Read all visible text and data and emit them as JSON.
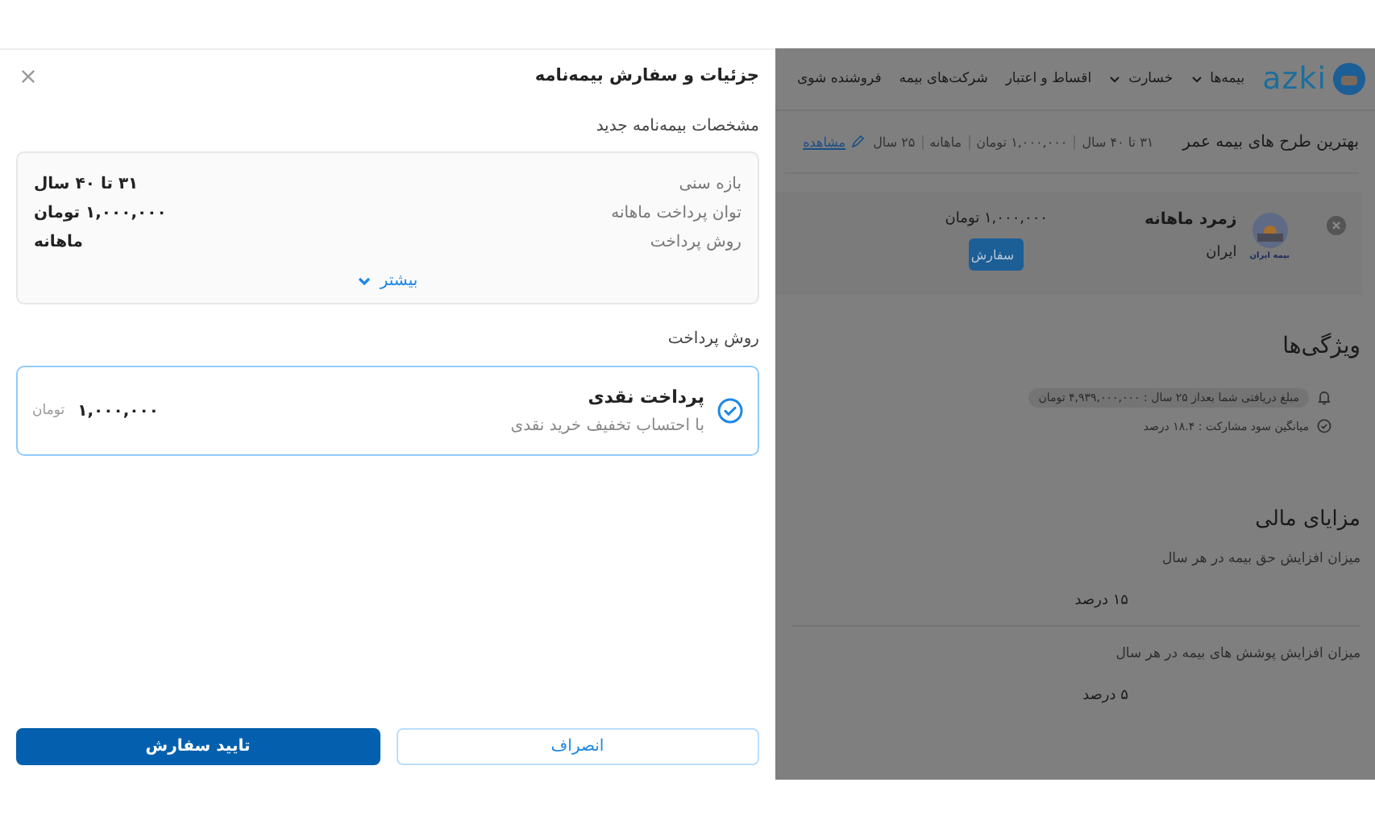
{
  "drawer": {
    "title": "جزئیات و سفارش بیمه‌نامه",
    "section_title": "مشخصات بیمه‌نامه جدید",
    "specs": [
      {
        "label": "بازه سنی",
        "value": "۳۱ تا ۴۰ سال"
      },
      {
        "label": "توان پرداخت ماهانه",
        "value": "۱,۰۰۰,۰۰۰ تومان"
      },
      {
        "label": "روش پرداخت",
        "value": "ماهانه"
      }
    ],
    "more_link": "بیشتر",
    "payment_title": "روش پرداخت",
    "payment_options": [
      {
        "title": "پرداخت نقدی",
        "subtitle": "با احتساب تخفیف خرید نقدی",
        "amount": "۱,۰۰۰,۰۰۰",
        "currency": "تومان",
        "selected": true
      }
    ],
    "buttons": [
      {
        "label": "انصراف",
        "kind": "secondary"
      },
      {
        "label": "تایید سفارش",
        "kind": "primary"
      }
    ]
  },
  "page": {
    "logo": "azki",
    "nav": [
      {
        "label": "بیمه‌ها",
        "dropdown": true
      },
      {
        "label": "خسارت",
        "dropdown": true
      },
      {
        "label": "اقساط و اعتبار",
        "dropdown": false
      },
      {
        "label": "شرکت‌های بیمه",
        "dropdown": false
      },
      {
        "label": "فروشنده شوی",
        "dropdown": false
      }
    ],
    "heading": "بهترین طرح های بیمه عمر",
    "filters": [
      "۳۱ تا ۴۰ سال",
      "۱,۰۰۰,۰۰۰ تومان",
      "ماهانه",
      "۲۵ سال"
    ],
    "edit_link": "مشاهده",
    "plan": {
      "name": "زمرد ماهانه",
      "company": "ایران",
      "logo_caption": "بیمه ایران",
      "price": "۱,۰۰۰,۰۰۰ تومان",
      "order_button": "سفارش"
    },
    "features_title": "ویژگی‌ها",
    "features": [
      {
        "text": "مبلغ دریافتی شما بعداز ۲۵ سال : ۴,۹۳۹,۰۰۰,۰۰۰ تومان",
        "kind": "bell"
      },
      {
        "text": "میانگین سود مشارکت : ۱۸.۴ درصد",
        "kind": "check"
      }
    ],
    "benefits_title": "مزایای مالی",
    "benefits": [
      {
        "label": "میزان افزایش حق بیمه در هر سال",
        "value": "۱۵ درصد"
      },
      {
        "label": "میزان افزایش پوشش های بیمه در هر سال",
        "value": "۵ درصد"
      }
    ]
  }
}
